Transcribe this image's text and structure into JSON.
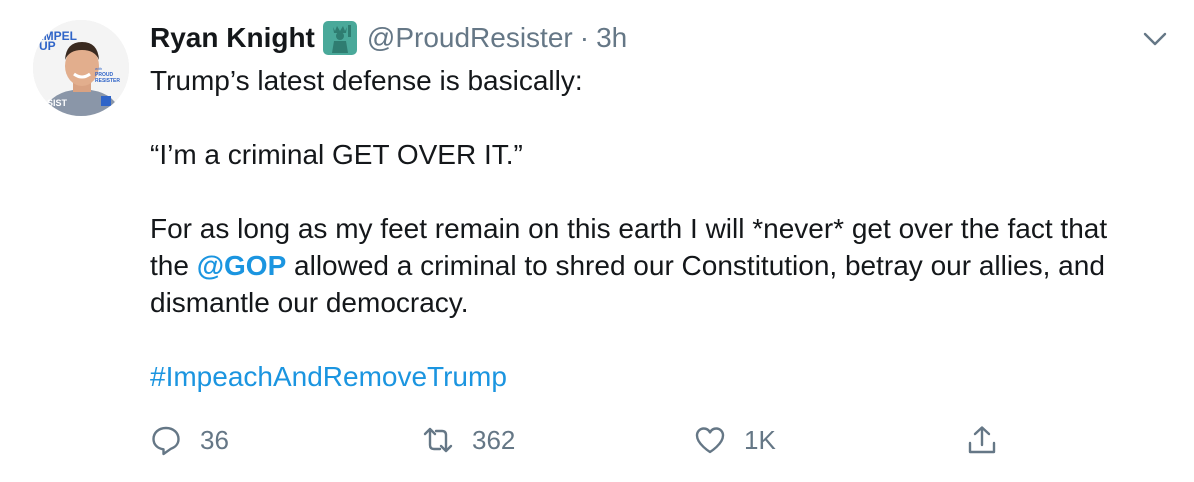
{
  "author": {
    "name": "Ryan Knight",
    "handle": "@ProudResister",
    "separator": "·",
    "time": "3h",
    "badge_icon": "statue-of-liberty-emoji",
    "avatar_text": {
      "line1": "AMPEL",
      "line2": "UP",
      "with": "with",
      "brand1": "PROUD",
      "brand2": "RESISTER",
      "shirt": "SIST"
    }
  },
  "tweet": {
    "line1": "Trump’s latest defense is basically:",
    "quote": "“I’m a criminal GET OVER IT.”",
    "para_line1": "For as long as my feet remain on this earth I will *never* get over the fact that",
    "para_line2_before": "the ",
    "mention": "@GOP",
    "para_line2_after": " allowed a criminal to shred our Constitution, betray our allies, and",
    "para_line3": "dismantle our democracy.",
    "hashtag": "#ImpeachAndRemoveTrump"
  },
  "actions": {
    "reply_count": "36",
    "retweet_count": "362",
    "like_count": "1K"
  },
  "colors": {
    "text": "#14171a",
    "secondary": "#657786",
    "link": "#1b95e0",
    "badge": "#4aa99a"
  }
}
